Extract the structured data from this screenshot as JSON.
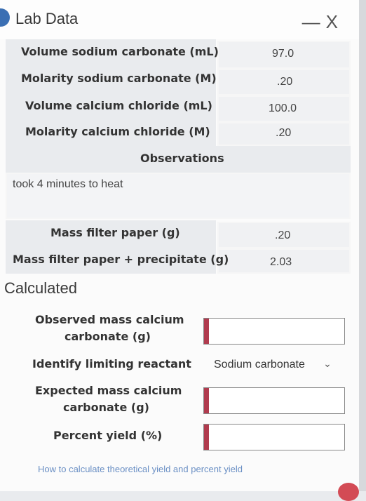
{
  "window": {
    "title": "Lab Data",
    "minimize": "—",
    "close": "X"
  },
  "lab_data": [
    {
      "label": "Volume sodium carbonate (mL)",
      "value": "97.0"
    },
    {
      "label": "Molarity sodium carbonate (M)",
      "value": ".20"
    },
    {
      "label": "Volume calcium chloride (mL)",
      "value": "100.0"
    },
    {
      "label": "Molarity calcium chloride (M)",
      "value": ".20"
    }
  ],
  "observations": {
    "header": "Observations",
    "text": "took 4 minutes to heat"
  },
  "masses": [
    {
      "label": "Mass filter paper (g)",
      "value": ".20"
    },
    {
      "label": "Mass filter paper + precipitate (g)",
      "value": "2.03"
    }
  ],
  "calculated": {
    "header": "Calculated",
    "observed_mass_label_1": "Observed mass calcium",
    "observed_mass_label_2": "carbonate (g)",
    "observed_mass_value": "",
    "limiting_label": "Identify limiting reactant",
    "limiting_value": "Sodium carbonate",
    "expected_mass_label_1": "Expected mass calcium",
    "expected_mass_label_2": "carbonate (g)",
    "expected_mass_value": "",
    "percent_yield_label": "Percent yield (%)",
    "percent_yield_value": ""
  },
  "help_link": "How to calculate theoretical yield and percent yield"
}
